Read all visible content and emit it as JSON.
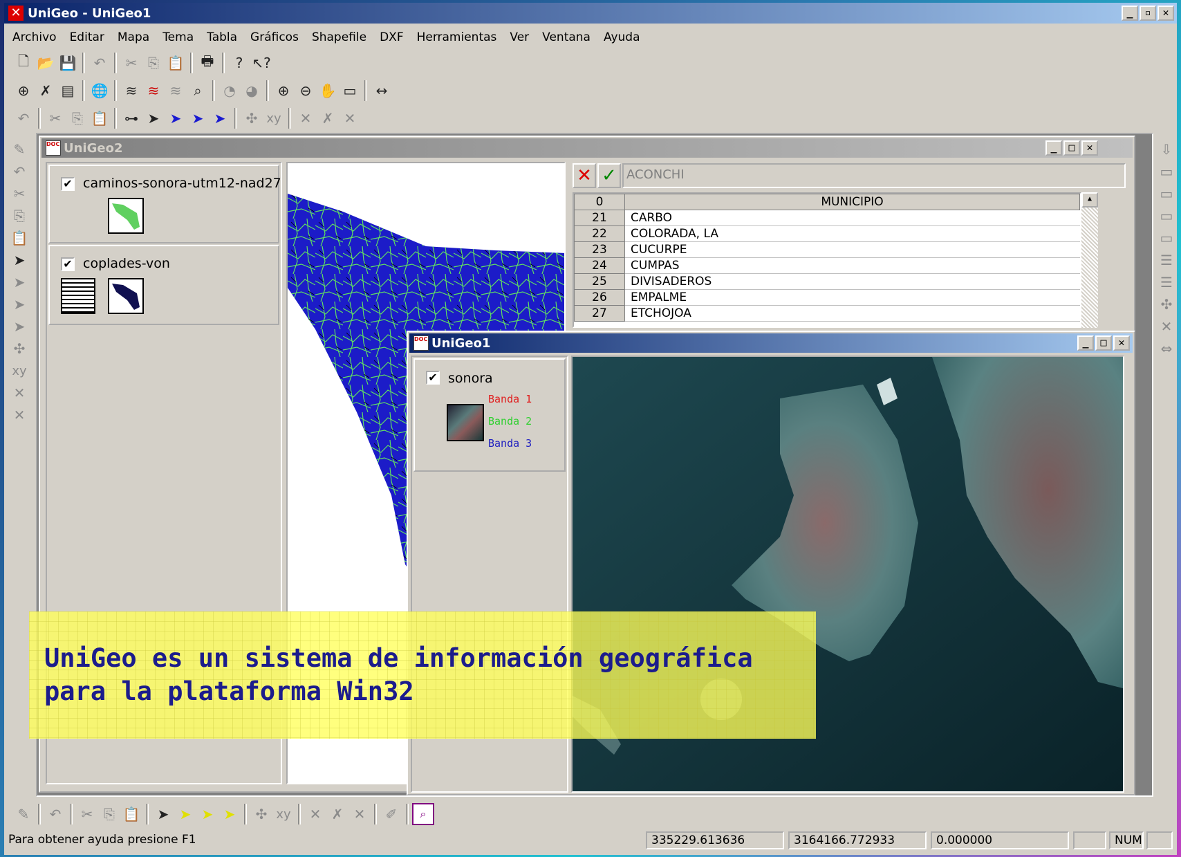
{
  "app": {
    "title": "UniGeo - UniGeo1"
  },
  "menu": [
    "Archivo",
    "Editar",
    "Mapa",
    "Tema",
    "Tabla",
    "Gráficos",
    "Shapefile",
    "DXF",
    "Herramientas",
    "Ver",
    "Ventana",
    "Ayuda"
  ],
  "win2": {
    "title": "UniGeo2",
    "layers": [
      {
        "name": "caminos-sonora-utm12-nad27"
      },
      {
        "name": "coplades-von"
      }
    ],
    "table": {
      "edit_value": "ACONCHI",
      "header_index": "0",
      "header_col": "MUNICIPIO",
      "rows": [
        {
          "id": "21",
          "name": "CARBO"
        },
        {
          "id": "22",
          "name": "COLORADA, LA"
        },
        {
          "id": "23",
          "name": "CUCURPE"
        },
        {
          "id": "24",
          "name": "CUMPAS"
        },
        {
          "id": "25",
          "name": "DIVISADEROS"
        },
        {
          "id": "26",
          "name": "EMPALME"
        },
        {
          "id": "27",
          "name": "ETCHOJOA"
        }
      ]
    }
  },
  "win1": {
    "title": "UniGeo1",
    "layer": "sonora",
    "bands": [
      {
        "label": "Banda 1",
        "color": "#e02020"
      },
      {
        "label": "Banda 2",
        "color": "#30d030"
      },
      {
        "label": "Banda 3",
        "color": "#2020c0"
      }
    ]
  },
  "banner": {
    "line1": "UniGeo es un sistema de información geográfica",
    "line2": "para la plataforma Win32"
  },
  "status": {
    "help": "Para obtener ayuda presione F1",
    "x": "335229.613636",
    "y": "3164166.772933",
    "z": "0.000000",
    "num": "NUM"
  },
  "colors": {
    "map_blue": "#1c1cc8",
    "road_green": "#60e060",
    "title_active": "#0a246a",
    "banner_bg": "#ffff66"
  }
}
